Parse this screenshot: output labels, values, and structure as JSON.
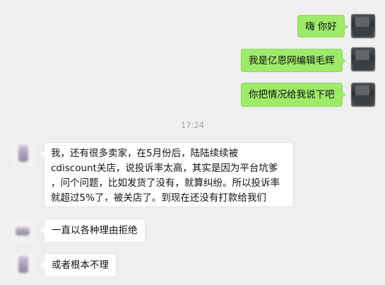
{
  "conversation": {
    "timestamp": "17:24",
    "sent": [
      {
        "text": "嗨 你好"
      },
      {
        "text": "我是亿恩网编辑毛辉"
      },
      {
        "text": "你把情况给我说下吧"
      }
    ],
    "received": [
      {
        "lines": [
          "我，还有很多卖家，在5月份后，陆陆续续被",
          "cdiscount关店，说投诉率太高，其实是因为平台坑爹",
          "，问个问题，比如发货了没有，就算纠纷。所以投诉率",
          "就超过5%了，被关店了。到现在还没有打款给我们"
        ]
      },
      {
        "text": "一直以各种理由拒绝"
      },
      {
        "text": "或者根本不理"
      }
    ]
  },
  "colors": {
    "background": "#efefef",
    "sent_bubble": "#9eea6a",
    "received_bubble": "#ffffff",
    "timestamp": "#a8a8a8"
  },
  "icons": {
    "own_avatar": "avatar-icon",
    "contact_avatar": "avatar-icon"
  }
}
